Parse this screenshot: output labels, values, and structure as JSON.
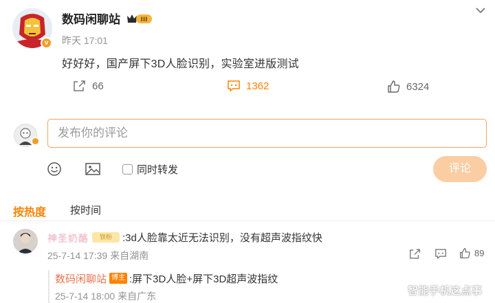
{
  "post": {
    "author": "数码闲聊站",
    "level": "III",
    "verified_mark": "v",
    "time": "昨天 17:01",
    "text": "好好好，国产屏下3D人脸识别，实验室进版测试",
    "forward_count": "66",
    "comment_count": "1362",
    "like_count": "6324"
  },
  "composer": {
    "placeholder": "发布你的评论",
    "repost_label": "同时转发",
    "submit_label": "评论"
  },
  "sort": {
    "hot": "按热度",
    "time": "按时间"
  },
  "comment": {
    "username": "神圣奶酪",
    "badge": "铁粉",
    "text": ":3d人脸靠太近无法识别，没有超声波指纹快",
    "meta": "25-7-14 17:39 来自湖南",
    "like_count": "89"
  },
  "reply": {
    "username": "数码闲聊站",
    "badge": "博主",
    "text": ":屏下3D人脸+屏下3D超声波指纹",
    "meta": "25-7-14 18:00 来自广东"
  },
  "watermark": "智能手机这点事",
  "colors": {
    "accent": "#ff8200",
    "input_border": "#f5a25d",
    "submit_disabled": "#fbcda3",
    "reply_name": "#eb7350"
  }
}
